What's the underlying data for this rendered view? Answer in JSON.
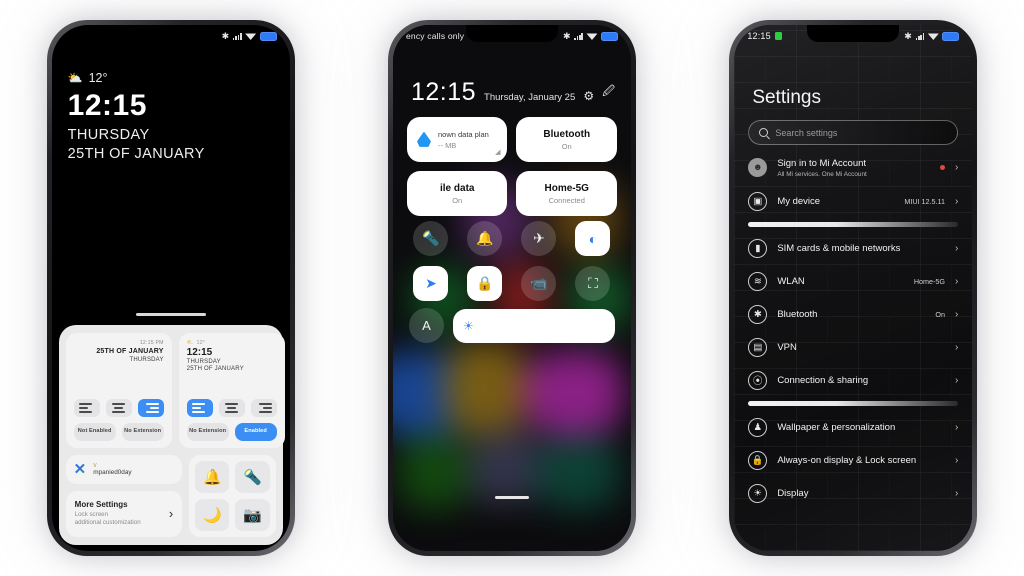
{
  "phone1": {
    "name": "lock-screen-editor",
    "statusbar": {
      "left": "",
      "icons": [
        "bluetooth-icon",
        "signal-icon",
        "wifi-icon",
        "battery-icon"
      ]
    },
    "lock": {
      "weather_icon": "partly-cloudy-icon",
      "temperature": "12°",
      "time": "12:15",
      "weekday": "THURSDAY",
      "date": "25TH OF JANUARY"
    },
    "editor": {
      "preview_left": {
        "time": "12:15 PM",
        "date": "25TH OF JANUARY",
        "weekday": "THURSDAY",
        "alignment_selected": "right",
        "pill_1": "Not Enabled",
        "pill_1_on": false,
        "pill_2": "No Extension",
        "pill_2_on": false
      },
      "preview_right": {
        "temperature": "12°",
        "time": "12:15",
        "weekday": "THURSDAY",
        "date": "25TH OF JANUARY",
        "alignment_selected": "left",
        "pill_1": "No Extension",
        "pill_1_on": false,
        "pill_2": "Enabled",
        "pill_2_on": true
      },
      "notification": {
        "app_icon": "x-app-icon",
        "line1": "V",
        "line2": "mpanied0day"
      },
      "more_settings": {
        "title": "More Settings",
        "subtitle": "Lock screen\nadditional customization",
        "chevron": "chevron-right-icon"
      },
      "shortcut_tiles": [
        {
          "name": "bell-icon",
          "glyph": "🔔"
        },
        {
          "name": "flashlight-icon",
          "glyph": "🔦"
        },
        {
          "name": "moon-icon",
          "glyph": "🌙"
        },
        {
          "name": "camera-icon",
          "glyph": "📷"
        }
      ]
    }
  },
  "phone2": {
    "name": "control-center",
    "statusbar": {
      "left": "ency calls only"
    },
    "header": {
      "time": "12:15",
      "date": "Thursday, January 25",
      "icons": [
        "settings-gear-icon",
        "edit-icon"
      ]
    },
    "cards": [
      {
        "name": "data-plan-card",
        "title": "nown data plan",
        "value": "-- MB",
        "icon": "data-drop-icon",
        "corner": "signal-icon"
      },
      {
        "name": "bluetooth-card",
        "title": "Bluetooth",
        "value": "On"
      },
      {
        "name": "mobile-data-card",
        "title": "ile data",
        "value": "On"
      },
      {
        "name": "wifi-card",
        "title": "Home-5G",
        "value": "Connected"
      }
    ],
    "toggles": [
      {
        "name": "flashlight-toggle",
        "glyph": "🔦",
        "on": false
      },
      {
        "name": "silent-bell-toggle",
        "glyph": "🔔",
        "on": false
      },
      {
        "name": "airplane-mode-toggle",
        "glyph": "✈",
        "on": false
      },
      {
        "name": "dark-mode-toggle",
        "glyph": "◐",
        "on": true
      },
      {
        "name": "location-toggle",
        "glyph": "➤",
        "on": true
      },
      {
        "name": "auto-rotate-toggle",
        "glyph": "🔒",
        "on": true
      },
      {
        "name": "screen-record-toggle",
        "glyph": "📹",
        "on": false
      },
      {
        "name": "scanner-toggle",
        "glyph": "⛶",
        "on": false
      }
    ],
    "brightness": {
      "auto_label": "A",
      "slider_icon": "brightness-sun-icon"
    }
  },
  "phone3": {
    "name": "settings-app",
    "statusbar": {
      "time": "12:15",
      "indicator": "green-status-dot"
    },
    "title": "Settings",
    "search": {
      "placeholder": "Search settings",
      "icon": "search-icon"
    },
    "items": [
      {
        "name": "sign-in-mi-account",
        "icon": "account-icon",
        "title": "Sign in to Mi Account",
        "subtitle": "All Mi services. One Mi Account",
        "value": "",
        "badge": true
      },
      {
        "name": "my-device",
        "icon": "device-icon",
        "title": "My device",
        "subtitle": "",
        "value": "MIUI 12.5.11"
      },
      {
        "name": "divider-1",
        "type": "divider"
      },
      {
        "name": "sim-cards-mobile-networks",
        "icon": "sim-icon",
        "title": "SIM cards & mobile networks",
        "subtitle": "",
        "value": ""
      },
      {
        "name": "wlan",
        "icon": "wifi-icon",
        "title": "WLAN",
        "subtitle": "",
        "value": "Home-5G"
      },
      {
        "name": "bluetooth",
        "icon": "bluetooth-icon",
        "title": "Bluetooth",
        "subtitle": "",
        "value": "On"
      },
      {
        "name": "vpn",
        "icon": "vpn-icon",
        "title": "VPN",
        "subtitle": "",
        "value": ""
      },
      {
        "name": "connection-sharing",
        "icon": "connection-icon",
        "title": "Connection & sharing",
        "subtitle": "",
        "value": ""
      },
      {
        "name": "divider-2",
        "type": "divider"
      },
      {
        "name": "wallpaper-personalization",
        "icon": "wallpaper-icon",
        "title": "Wallpaper & personalization",
        "subtitle": "",
        "value": ""
      },
      {
        "name": "always-on-display-lock-screen",
        "icon": "lock-icon",
        "title": "Always-on display & Lock screen",
        "subtitle": "",
        "value": ""
      },
      {
        "name": "display",
        "icon": "display-icon",
        "title": "Display",
        "subtitle": "",
        "value": ""
      }
    ],
    "chevron": "chevron-right-icon"
  }
}
